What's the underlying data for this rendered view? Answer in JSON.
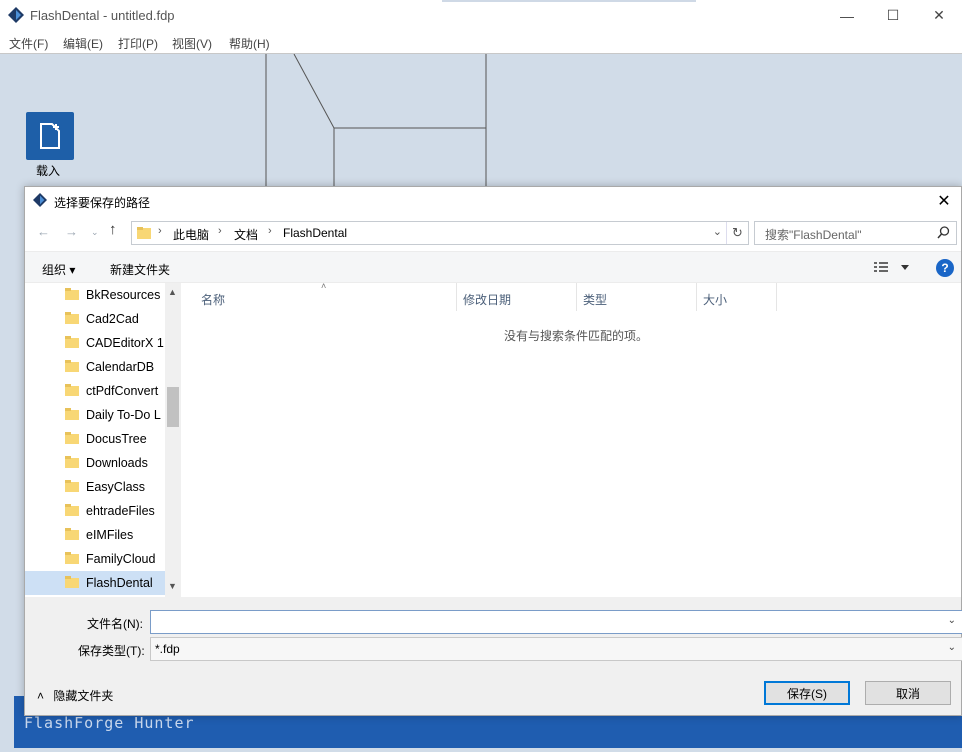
{
  "app": {
    "title": "FlashDental - untitled.fdp",
    "menu": [
      "文件(F)",
      "编辑(E)",
      "打印(P)",
      "视图(V)",
      "帮助(H)"
    ],
    "load_label": "载入",
    "footer_text": "FlashForge Hunter",
    "colors": {
      "brand_blue": "#1f5db0",
      "workspace_bg": "#d1dce8"
    }
  },
  "dialog": {
    "title": "选择要保存的路径",
    "breadcrumb": [
      "此电脑",
      "文档",
      "FlashDental"
    ],
    "search_placeholder": "搜索\"FlashDental\"",
    "toolbar": {
      "organize": "组织 ▾",
      "new_folder": "新建文件夹"
    },
    "tree_items": [
      "BkResources",
      "Cad2Cad",
      "CADEditorX 1",
      "CalendarDB",
      "ctPdfConvert",
      "Daily To-Do L",
      "DocusTree",
      "Downloads",
      "EasyClass",
      "ehtradeFiles",
      "eIMFiles",
      "FamilyCloud",
      "FlashDental"
    ],
    "selected_item": "FlashDental",
    "columns": [
      "名称",
      "修改日期",
      "类型",
      "大小"
    ],
    "empty_message": "没有与搜索条件匹配的项。",
    "filename_label": "文件名(N):",
    "filename_value": "",
    "filetype_label": "保存类型(T):",
    "filetype_value": "*.fdp",
    "hide_folders": "隐藏文件夹",
    "save_button": "保存(S)",
    "cancel_button": "取消"
  }
}
